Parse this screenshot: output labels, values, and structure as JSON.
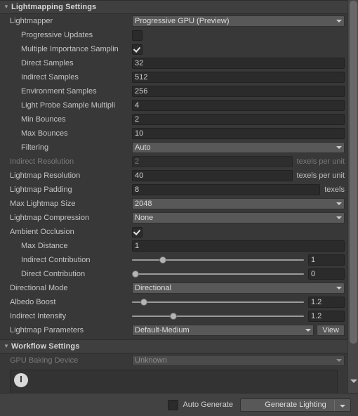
{
  "sections": [
    {
      "title": "Lightmapping Settings",
      "foldout_icon": "chevron-down-icon",
      "expanded": true
    },
    {
      "title": "Workflow Settings",
      "foldout_icon": "chevron-down-icon",
      "expanded": true
    }
  ],
  "lightmapping": {
    "lightmapper": {
      "label": "Lightmapper",
      "value": "Progressive GPU (Preview)"
    },
    "progressive_updates": {
      "label": "Progressive Updates",
      "checked": false
    },
    "multiple_importance_sampling": {
      "label": "Multiple Importance Samplin",
      "checked": true
    },
    "direct_samples": {
      "label": "Direct Samples",
      "value": "32"
    },
    "indirect_samples": {
      "label": "Indirect Samples",
      "value": "512"
    },
    "environment_samples": {
      "label": "Environment Samples",
      "value": "256"
    },
    "light_probe_sample_multiplier": {
      "label": "Light Probe Sample Multipli",
      "value": "4"
    },
    "min_bounces": {
      "label": "Min Bounces",
      "value": "2"
    },
    "max_bounces": {
      "label": "Max Bounces",
      "value": "10"
    },
    "filtering": {
      "label": "Filtering",
      "value": "Auto"
    },
    "indirect_resolution": {
      "label": "Indirect Resolution",
      "value": "2",
      "suffix": "texels per unit",
      "disabled": true
    },
    "lightmap_resolution": {
      "label": "Lightmap Resolution",
      "value": "40",
      "suffix": "texels per unit"
    },
    "lightmap_padding": {
      "label": "Lightmap Padding",
      "value": "8",
      "suffix": "texels"
    },
    "max_lightmap_size": {
      "label": "Max Lightmap Size",
      "value": "2048"
    },
    "lightmap_compression": {
      "label": "Lightmap Compression",
      "value": "None"
    },
    "ambient_occlusion": {
      "label": "Ambient Occlusion",
      "checked": true
    },
    "max_distance": {
      "label": "Max Distance",
      "value": "1"
    },
    "indirect_contribution": {
      "label": "Indirect Contribution",
      "value": "1",
      "slider_pct": 18
    },
    "direct_contribution": {
      "label": "Direct Contribution",
      "value": "0",
      "slider_pct": 2
    },
    "directional_mode": {
      "label": "Directional Mode",
      "value": "Directional"
    },
    "albedo_boost": {
      "label": "Albedo Boost",
      "value": "1.2",
      "slider_pct": 7
    },
    "indirect_intensity": {
      "label": "Indirect Intensity",
      "value": "1.2",
      "slider_pct": 24
    },
    "lightmap_parameters": {
      "label": "Lightmap Parameters",
      "value": "Default-Medium",
      "button_label": "View"
    }
  },
  "workflow": {
    "gpu_baking_device": {
      "label": "GPU Baking Device",
      "value": "Unknown",
      "disabled": true
    },
    "helpbox": {
      "icon": "warning-icon",
      "text": ""
    }
  },
  "bottom_bar": {
    "auto_generate": {
      "label": "Auto Generate",
      "checked": false
    },
    "generate_lighting": {
      "label": "Generate Lighting",
      "dropdown_icon": "chevron-down-icon"
    }
  },
  "scrollbar": {
    "name": "vertical-scrollbar",
    "down_arrow": "chevron-down-icon"
  },
  "colors": {
    "window_bg": "#383838",
    "header_bg": "#3f3f3f",
    "field_bg": "#2b2b2b",
    "dropdown_bg": "#585858",
    "text": "#c4c4c4",
    "disabled_text": "#7a7a7a",
    "bottom_bar_bg": "#424242"
  }
}
